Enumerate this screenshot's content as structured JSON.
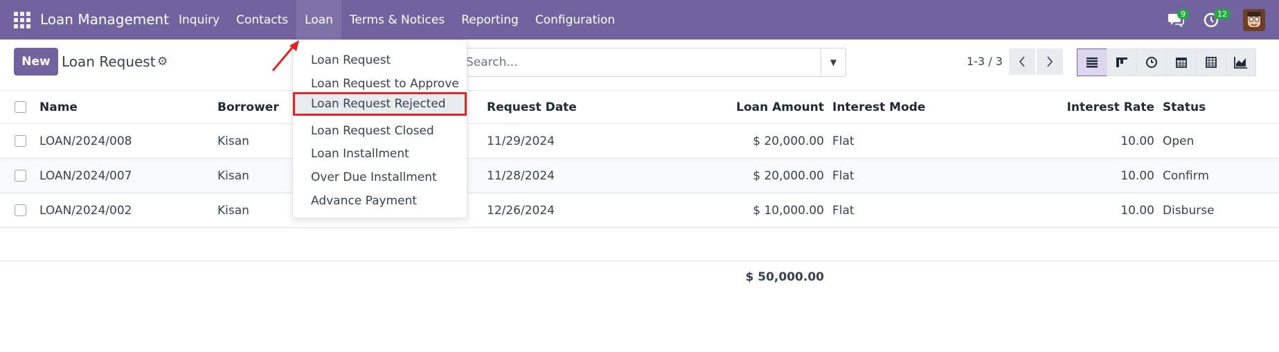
{
  "navbar": {
    "brand": "Loan Management",
    "menu": [
      "Inquiry",
      "Contacts",
      "Loan",
      "Terms & Notices",
      "Reporting",
      "Configuration"
    ],
    "active_menu": "Loan",
    "messages_badge": "9",
    "activities_badge": "12",
    "color": "#71639e"
  },
  "control": {
    "new_label": "New",
    "title": "Loan Request",
    "search_placeholder": "Search...",
    "pager": "1-3 / 3",
    "views": [
      "list-view-icon",
      "kanban-view-icon",
      "activity-view-icon",
      "calendar-view-icon",
      "pivot-view-icon",
      "graph-view-icon"
    ]
  },
  "table": {
    "headers": {
      "name": "Name",
      "borrower": "Borrower",
      "request_date": "Request Date",
      "loan_amount": "Loan Amount",
      "interest_mode": "Interest Mode",
      "interest_rate": "Interest Rate",
      "status": "Status"
    },
    "rows": [
      {
        "name": "LOAN/2024/008",
        "borrower": "Kisan",
        "request_date": "11/29/2024",
        "loan_amount": "$ 20,000.00",
        "interest_mode": "Flat",
        "interest_rate": "10.00",
        "status": "Open"
      },
      {
        "name": "LOAN/2024/007",
        "borrower": "Kisan",
        "request_date": "11/28/2024",
        "loan_amount": "$ 20,000.00",
        "interest_mode": "Flat",
        "interest_rate": "10.00",
        "status": "Confirm"
      },
      {
        "name": "LOAN/2024/002",
        "borrower": "Kisan",
        "request_date": "12/26/2024",
        "loan_amount": "$ 10,000.00",
        "interest_mode": "Flat",
        "interest_rate": "10.00",
        "status": "Disburse"
      }
    ],
    "total": "$ 50,000.00"
  },
  "dropdown": {
    "items": [
      "Loan Request",
      "Loan Request to Approve",
      "Loan Request Rejected",
      "Loan Request Closed",
      "Loan Installment",
      "Over Due Installment",
      "Advance Payment"
    ],
    "highlighted": "Loan Request Rejected",
    "highlight_color": "#e32424"
  }
}
